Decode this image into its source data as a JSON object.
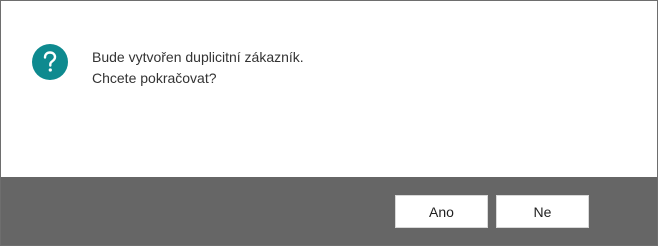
{
  "dialog": {
    "icon": "question-mark-icon",
    "icon_color": "#0e8a8f",
    "message_line1": "Bude vytvořen duplicitní zákazník.",
    "message_line2": "Chcete pokračovat?",
    "footer_color": "#666666",
    "yes_label": "Ano",
    "no_label": "Ne"
  }
}
